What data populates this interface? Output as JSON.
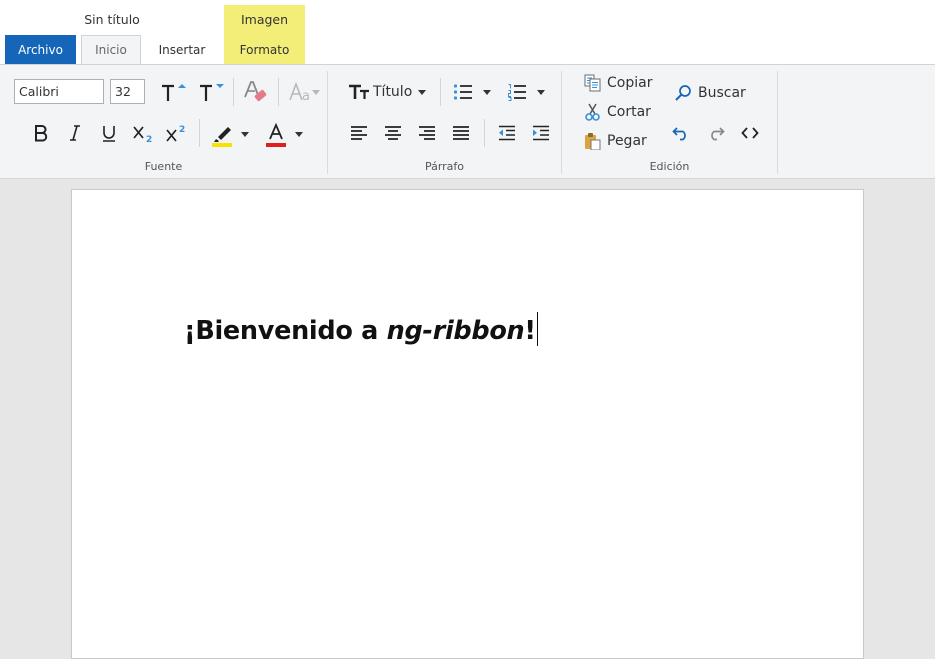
{
  "document": {
    "title": "Sin título"
  },
  "contextual_group": {
    "label": "Imagen"
  },
  "tabs": [
    {
      "label": "Archivo"
    },
    {
      "label": "Inicio"
    },
    {
      "label": "Insertar"
    },
    {
      "label": "Formato"
    }
  ],
  "ribbon": {
    "fuente": {
      "label": "Fuente",
      "font_family": "Calibri",
      "font_size": "32"
    },
    "parrafo": {
      "label": "Párrafo",
      "style": "Título"
    },
    "edicion": {
      "label": "Edición",
      "copy": "Copiar",
      "cut": "Cortar",
      "paste": "Pegar",
      "find": "Buscar"
    }
  },
  "content": {
    "part1": "¡Bienvenido a ",
    "part2": "ng-ribbon",
    "part3": "!"
  },
  "colors": {
    "archivo_tab": "#1565b8",
    "contextual": "#f2ee78",
    "highlight": "#f5e400",
    "font_color": "#e02020"
  }
}
